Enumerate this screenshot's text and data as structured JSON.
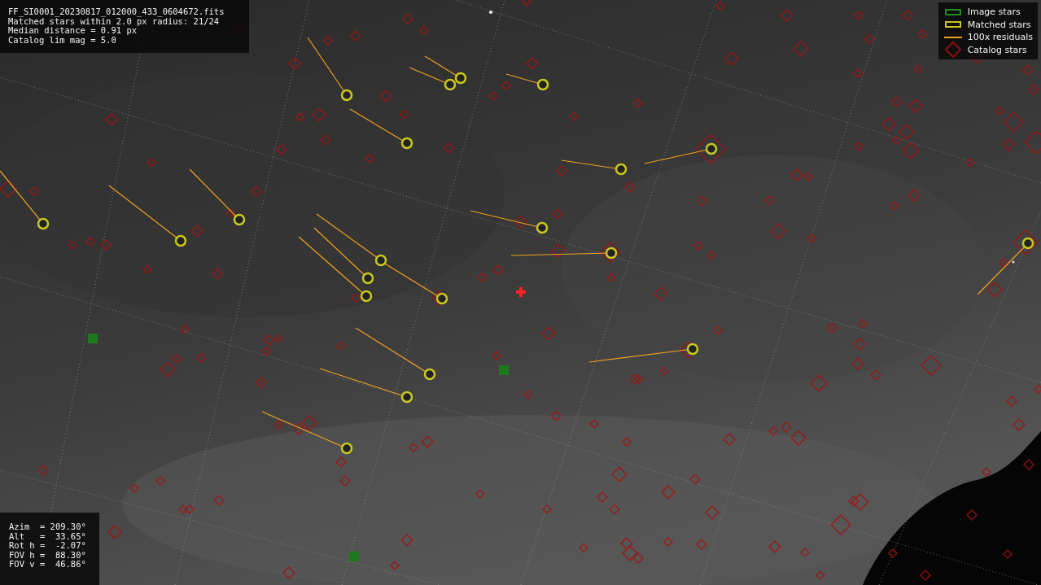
{
  "file_info": {
    "lines": [
      "FF_SI0001_20230817_012000_433_0604672.fits",
      "Matched stars within 2.0 px radius: 21/24",
      "Median distance = 0.91 px",
      "Catalog lim mag = 5.0"
    ]
  },
  "legend": {
    "items": [
      {
        "kind": "square",
        "color": "#1f8a1f",
        "label": "Image stars"
      },
      {
        "kind": "square",
        "color": "#c8c81e",
        "label": "Matched stars"
      },
      {
        "kind": "line",
        "color": "#f0a020",
        "label": "100x residuals"
      },
      {
        "kind": "diamond",
        "color": "#8c1010",
        "label": "Catalog stars"
      }
    ]
  },
  "pointing": {
    "lines": [
      "Azim  = 209.30°",
      "Alt   =  33.65°",
      "Rot h =  -2.07°",
      "FOV h =  88.30°",
      "FOV v =  46.86°"
    ]
  }
}
